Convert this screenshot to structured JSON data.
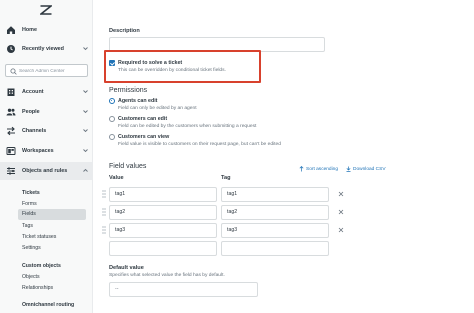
{
  "sidebar": {
    "nav": [
      {
        "label": "Home",
        "icon": "home-icon"
      },
      {
        "label": "Recently viewed",
        "icon": "clock-icon"
      },
      {
        "label": "Account",
        "icon": "building-icon"
      },
      {
        "label": "People",
        "icon": "people-icon"
      },
      {
        "label": "Channels",
        "icon": "arrows-icon"
      },
      {
        "label": "Workspaces",
        "icon": "workspace-icon"
      },
      {
        "label": "Objects and rules",
        "icon": "rules-icon"
      }
    ],
    "search_placeholder": "Search Admin Center",
    "tickets_heading": "Tickets",
    "tickets_items": [
      "Forms",
      "Fields",
      "Tags",
      "Ticket statuses",
      "Settings"
    ],
    "custom_objects_heading": "Custom objects",
    "custom_objects_items": [
      "Objects",
      "Relationships"
    ],
    "omnichannel_heading": "Omnichannel routing"
  },
  "main": {
    "description_label": "Description",
    "required": {
      "label": "Required to solve a ticket",
      "hint": "This can be overridden by conditional ticket fields."
    },
    "permissions": {
      "title": "Permissions",
      "options": [
        {
          "label": "Agents can edit",
          "hint": "Field can only be edited by an agent"
        },
        {
          "label": "Customers can edit",
          "hint": "Field can be edited by the customers when submitting a request"
        },
        {
          "label": "Customers can view",
          "hint": "Field value is visible to customers on their request page, but can't be edited"
        }
      ]
    },
    "field_values": {
      "title": "Field values",
      "sort_label": "Sort ascending",
      "download_label": "Download CSV",
      "col_value": "Value",
      "col_tag": "Tag",
      "rows": [
        {
          "value": "tag1",
          "tag": "tag1"
        },
        {
          "value": "tag2",
          "tag": "tag2"
        },
        {
          "value": "tag3",
          "tag": "tag3"
        }
      ]
    },
    "default_value": {
      "label": "Default value",
      "hint": "Specifies what selected value the field has by default.",
      "selected": "--"
    }
  },
  "colors": {
    "accent": "#1f73b7",
    "highlight_border": "#d8412d",
    "sidebar_bg": "#f8f9f9"
  }
}
